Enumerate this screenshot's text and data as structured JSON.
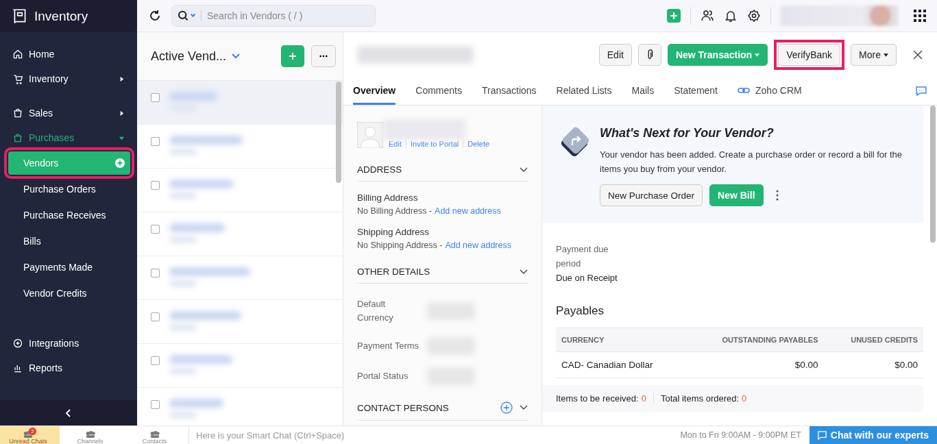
{
  "app": {
    "name": "Inventory"
  },
  "search": {
    "placeholder": "Search in Vendors ( / )"
  },
  "sidebar": {
    "items": [
      {
        "label": "Home",
        "selected": false
      },
      {
        "label": "Inventory",
        "selected": false,
        "expanded": false
      },
      {
        "label": "Sales",
        "selected": false,
        "expanded": false
      },
      {
        "label": "Purchases",
        "selected": true,
        "expanded": true,
        "children": [
          {
            "label": "Vendors",
            "selected": true,
            "highlighted": true
          },
          {
            "label": "Purchase Orders",
            "selected": false,
            "highlighted": false
          },
          {
            "label": "Purchase Receives",
            "selected": false,
            "highlighted": false
          },
          {
            "label": "Bills",
            "selected": false,
            "highlighted": false
          },
          {
            "label": "Payments Made",
            "selected": false,
            "highlighted": false
          },
          {
            "label": "Vendor Credits",
            "selected": false,
            "highlighted": false
          }
        ]
      },
      {
        "label": "Integrations",
        "selected": false
      },
      {
        "label": "Reports",
        "selected": false
      }
    ]
  },
  "list": {
    "title": "Active Vend...",
    "rows": [
      {
        "selected": true,
        "checked": false
      },
      {
        "selected": false,
        "checked": false
      },
      {
        "selected": false,
        "checked": false
      },
      {
        "selected": false,
        "checked": false
      },
      {
        "selected": false,
        "checked": false
      },
      {
        "selected": false,
        "checked": false
      },
      {
        "selected": false,
        "checked": false
      },
      {
        "selected": false,
        "checked": false
      }
    ]
  },
  "toolbar": {
    "buttons": [
      {
        "kind": "plain",
        "label": "Edit",
        "dropdown": false,
        "highlighted": false
      },
      {
        "kind": "attach"
      },
      {
        "kind": "primary",
        "label": "New Transaction",
        "dropdown": true,
        "highlighted": false
      },
      {
        "kind": "plain",
        "label": "VerifyBank",
        "dropdown": false,
        "highlighted": true
      },
      {
        "kind": "plain",
        "label": "More",
        "dropdown": true,
        "highlighted": false
      }
    ]
  },
  "tabs": [
    {
      "label": "Overview",
      "selected": true
    },
    {
      "label": "Comments",
      "selected": false
    },
    {
      "label": "Transactions",
      "selected": false
    },
    {
      "label": "Related Lists",
      "selected": false
    },
    {
      "label": "Mails",
      "selected": false
    },
    {
      "label": "Statement",
      "selected": false
    },
    {
      "label": "Zoho CRM",
      "selected": false,
      "kind": "link"
    }
  ],
  "profile": {
    "links": [
      "Edit",
      "Invite to Portal",
      "Delete"
    ]
  },
  "address": {
    "title": "ADDRESS",
    "expanded": true,
    "entries": [
      {
        "label": "Billing Address",
        "value": "No Billing Address -",
        "link": "Add new address"
      },
      {
        "label": "Shipping Address",
        "value": "No Shipping Address -",
        "link": "Add new address"
      }
    ]
  },
  "other_details": {
    "title": "OTHER DETAILS",
    "expanded": true,
    "fields": [
      "Default Currency",
      "Payment Terms",
      "Portal Status"
    ]
  },
  "contact_persons": {
    "title": "CONTACT PERSONS",
    "expanded": false
  },
  "next_card": {
    "title": "What's Next for Your Vendor?",
    "text": "Your vendor has been added. Create a purchase order or record a bill for the items you buy from your vendor.",
    "buttons": [
      {
        "label": "New Purchase Order",
        "kind": "plain"
      },
      {
        "label": "New Bill",
        "kind": "primary"
      }
    ]
  },
  "payment": {
    "label": "Payment due period",
    "value": "Due on Receipt"
  },
  "payables": {
    "title": "Payables",
    "columns": [
      "CURRENCY",
      "OUTSTANDING PAYABLES",
      "UNUSED CREDITS"
    ],
    "rows": [
      [
        "CAD- Canadian Dollar",
        "$0.00",
        "$0.00"
      ]
    ]
  },
  "summary": [
    {
      "label": "Items to be received:",
      "value": "0"
    },
    {
      "label": "Total items ordered:",
      "value": "0"
    }
  ],
  "bottom_bar": {
    "tabs": [
      {
        "label": "Unread Chats",
        "badge": "2",
        "selected": true
      },
      {
        "label": "Channels",
        "selected": false
      },
      {
        "label": "Contacts",
        "selected": false
      }
    ],
    "placeholder": "Here is your Smart Chat (Ctrl+Space)",
    "hours": "Mon to Fri 9:00AM - 9:00PM ET",
    "chat_button": "Chat with our experts"
  }
}
